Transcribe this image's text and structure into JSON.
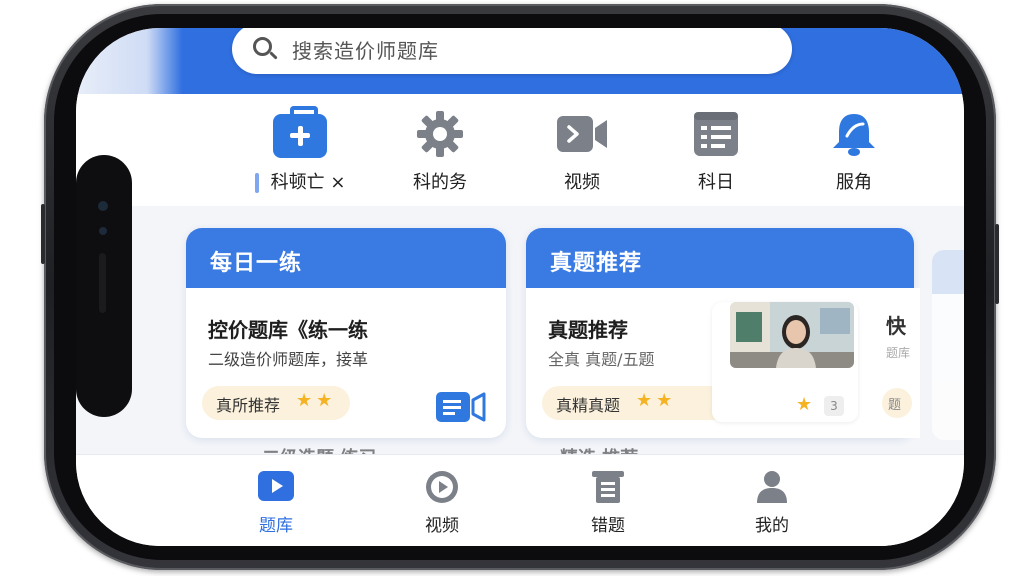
{
  "search": {
    "placeholder": "搜索造价师题库"
  },
  "categories": [
    {
      "label": "科顿亡 ×",
      "icon": "medical-kit-icon"
    },
    {
      "label": "科的务",
      "icon": "gear-icon"
    },
    {
      "label": "视频",
      "icon": "video-camera-icon"
    },
    {
      "label": "科日",
      "icon": "calendar-list-icon"
    },
    {
      "label": "服角",
      "icon": "bell-icon"
    }
  ],
  "cards": [
    {
      "header": "每日一练",
      "title": "控价题库《练一练",
      "subtitle": "二级造价师题库，接革",
      "badge": "真所推荐",
      "stars": "★★"
    },
    {
      "header": "真题推荐",
      "title": "真题推荐",
      "subtitle": "全真 真题/五题",
      "badge": "真精真题",
      "stars": "★★",
      "thumb_star": "★",
      "thumb_num": "3"
    }
  ],
  "peek": {
    "title": "快",
    "subtitle": "题库",
    "badge": "题"
  },
  "cut_text": [
    "二级造题 练习",
    "精选 推荐"
  ],
  "bottom_nav": [
    {
      "label": "题库",
      "icon": "play-square-icon",
      "active": true
    },
    {
      "label": "视频",
      "icon": "play-circle-icon",
      "active": false
    },
    {
      "label": "错题",
      "icon": "error-book-icon",
      "active": false
    },
    {
      "label": "我的",
      "icon": "user-icon",
      "active": false
    }
  ],
  "colors": {
    "primary": "#2f6fe0",
    "card_header": "#3a7ae3",
    "star": "#f5b324",
    "badge_bg": "#fbf1dc",
    "icon_gray": "#7c8088"
  }
}
